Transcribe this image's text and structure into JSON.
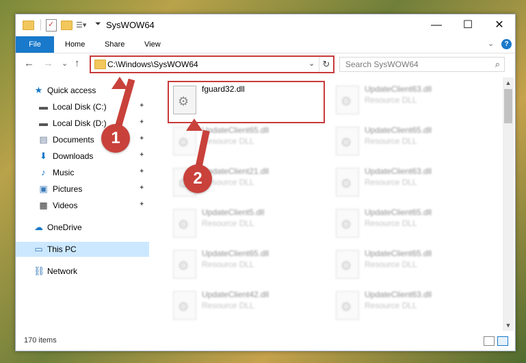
{
  "titlebar": {
    "title": "SysWOW64",
    "minimize": "—",
    "maximize": "☐",
    "close": "✕"
  },
  "ribbon": {
    "tabs": [
      "File",
      "Home",
      "Share",
      "View"
    ],
    "expand": "⌄",
    "help": "?"
  },
  "nav": {
    "back": "←",
    "forward": "→",
    "recent": "⌄",
    "up": "↑"
  },
  "address": {
    "path": "C:\\Windows\\SysWOW64",
    "dropdown": "⌄",
    "refresh": "↻"
  },
  "search": {
    "placeholder": "Search SysWOW64",
    "icon": "⌕"
  },
  "sidebar": {
    "items": [
      {
        "label": "Quick access",
        "icon": "star-icon",
        "glyph": "★",
        "color": "#1979ca",
        "pinned": false
      },
      {
        "label": "Local Disk (C:)",
        "icon": "drive-icon",
        "glyph": "▬",
        "color": "#555",
        "pinned": true
      },
      {
        "label": "Local Disk (D:)",
        "icon": "drive-icon",
        "glyph": "▬",
        "color": "#555",
        "pinned": true
      },
      {
        "label": "Documents",
        "icon": "documents-icon",
        "glyph": "▤",
        "color": "#6a7f99",
        "pinned": true
      },
      {
        "label": "Downloads",
        "icon": "download-arrow-icon",
        "glyph": "⬇",
        "color": "#1979ca",
        "pinned": true
      },
      {
        "label": "Music",
        "icon": "music-note-icon",
        "glyph": "♪",
        "color": "#1979ca",
        "pinned": true
      },
      {
        "label": "Pictures",
        "icon": "pictures-icon",
        "glyph": "▣",
        "color": "#3a7ab8",
        "pinned": true
      },
      {
        "label": "Videos",
        "icon": "film-icon",
        "glyph": "▦",
        "color": "#333",
        "pinned": true
      },
      {
        "label": "OneDrive",
        "icon": "cloud-icon",
        "glyph": "☁",
        "color": "#1979ca",
        "pinned": false
      },
      {
        "label": "This PC",
        "icon": "computer-icon",
        "glyph": "▭",
        "color": "#3a7ab8",
        "pinned": false,
        "selected": true
      },
      {
        "label": "Network",
        "icon": "network-icon",
        "glyph": "⛓",
        "color": "#3a7ab8",
        "pinned": false
      }
    ],
    "pin_glyph": "📌"
  },
  "files": [
    {
      "name": "fguard32.dll",
      "type": "",
      "highlighted": true
    },
    {
      "name": "UpdateClient63.dll",
      "type": "Resource DLL"
    },
    {
      "name": "UpdateClient65.dll",
      "type": "Resource DLL"
    },
    {
      "name": "UpdateClient65.dll",
      "type": "Resource DLL"
    },
    {
      "name": "UpdateClient21.dll",
      "type": "Resource DLL"
    },
    {
      "name": "UpdateClient63.dll",
      "type": "Resource DLL"
    },
    {
      "name": "UpdateClient5.dll",
      "type": "Resource DLL"
    },
    {
      "name": "UpdateClient65.dll",
      "type": "Resource DLL"
    },
    {
      "name": "UpdateClient65.dll",
      "type": "Resource DLL"
    },
    {
      "name": "UpdateClient65.dll",
      "type": "Resource DLL"
    },
    {
      "name": "UpdateClient42.dll",
      "type": "Resource DLL"
    },
    {
      "name": "UpdateClient63.dll",
      "type": "Resource DLL"
    }
  ],
  "status": {
    "item_count": "170 items"
  },
  "callouts": [
    "1",
    "2"
  ],
  "colors": {
    "accent": "#1979ca",
    "annotation": "#c9413b",
    "selected": "#cce8ff"
  }
}
